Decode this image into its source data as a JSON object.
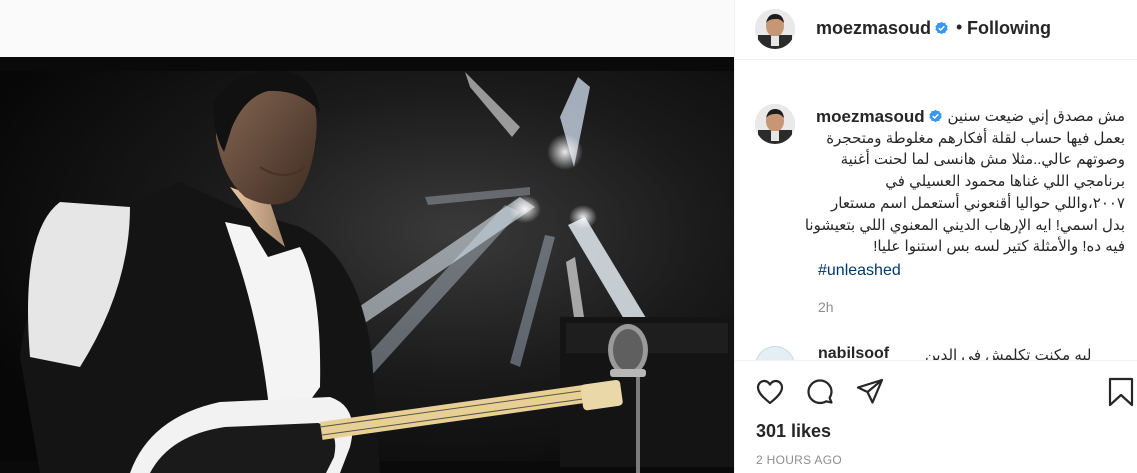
{
  "post": {
    "username": "moezmasoud",
    "follow_status": "Following",
    "separator": "•",
    "caption_lines": [
      "مش مصدق إني ضيعت سنين",
      "بعمل فيها حساب لقلة أفكارهم مغلوطة ومتحجرة",
      "وصوتهم عالي..مثلا مش هانسى لما لحنت أغنية",
      "برنامجي اللي غناها محمود العسيلي في",
      "٢٠٠٧،واللي حواليا أقنعوني أستعمل اسم مستعار",
      "بدل اسمي! ايه الإرهاب الديني المعنوي اللي بتعيشونا",
      "فيه ده! والأمثلة كتير لسه بس استنوا عليا!"
    ],
    "hashtag": "#unleashed",
    "caption_time": "2h",
    "likes": "301 likes",
    "timestamp": "2 HOURS AGO"
  },
  "comment_peek": {
    "username": "nabilsoof",
    "text": "ليه مكنت تكلمش في الدين"
  },
  "icons": {
    "verified": "verified-badge-icon",
    "like": "heart-icon",
    "comment": "comment-bubble-icon",
    "share": "paper-plane-icon",
    "save": "bookmark-icon"
  },
  "colors": {
    "verified": "#3897f0",
    "hashtag": "#00376b",
    "muted": "#8e8e8e",
    "border": "#efefef"
  }
}
